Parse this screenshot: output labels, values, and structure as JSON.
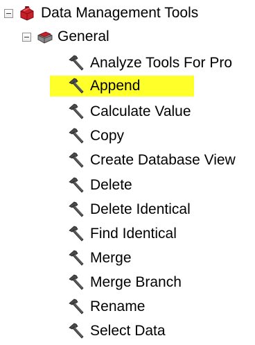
{
  "tree": {
    "root": {
      "label": "Data Management Tools",
      "icon": "toolbox-icon",
      "expanded": true
    },
    "group": {
      "label": "General",
      "icon": "toolset-icon",
      "expanded": true
    },
    "tools": [
      {
        "label": "Analyze Tools For Pro",
        "icon": "hammer-icon",
        "selected": false
      },
      {
        "label": "Append",
        "icon": "hammer-icon",
        "selected": true
      },
      {
        "label": "Calculate Value",
        "icon": "hammer-icon",
        "selected": false
      },
      {
        "label": "Copy",
        "icon": "hammer-icon",
        "selected": false
      },
      {
        "label": "Create Database View",
        "icon": "hammer-icon",
        "selected": false
      },
      {
        "label": "Delete",
        "icon": "hammer-icon",
        "selected": false
      },
      {
        "label": "Delete Identical",
        "icon": "hammer-icon",
        "selected": false
      },
      {
        "label": "Find Identical",
        "icon": "hammer-icon",
        "selected": false
      },
      {
        "label": "Merge",
        "icon": "hammer-icon",
        "selected": false
      },
      {
        "label": "Merge Branch",
        "icon": "hammer-icon",
        "selected": false
      },
      {
        "label": "Rename",
        "icon": "hammer-icon",
        "selected": false
      },
      {
        "label": "Select Data",
        "icon": "hammer-icon",
        "selected": false
      }
    ]
  },
  "colors": {
    "selection": "#ffff2a",
    "toolbox_red": "#c8202a",
    "toolset_gray": "#6e6e6e",
    "hammer_dark": "#3c3c3c"
  }
}
